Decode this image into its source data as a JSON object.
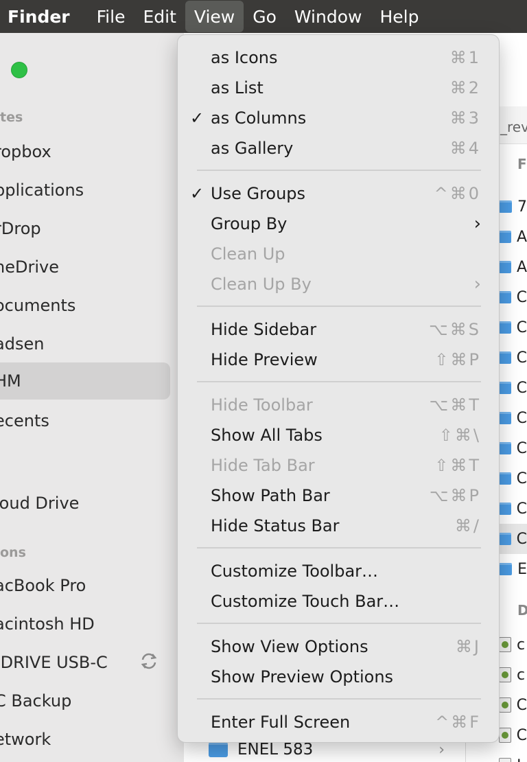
{
  "menubar": {
    "app": "Finder",
    "items": [
      "File",
      "Edit",
      "View",
      "Go",
      "Window",
      "Help"
    ]
  },
  "sidebar": {
    "section_favorites": "tes",
    "items_fav": [
      "ropbox",
      "pplications",
      "rDrop",
      "neDrive",
      "ocuments",
      "adsen",
      "HM",
      "ecents"
    ],
    "icloud": "loud Drive",
    "section_locations": "ons",
    "items_loc": [
      "acBook Pro",
      "acintosh HD",
      "-DRIVE USB-C",
      "C Backup",
      "etwork"
    ]
  },
  "column3": {
    "title": "_rev",
    "header_letter": "F",
    "section_letter": "D",
    "rows": [
      "7",
      "A",
      "A",
      "C",
      "C",
      "C",
      "C",
      "C",
      "C",
      "C",
      "C",
      "C",
      "E"
    ],
    "doc_rows": [
      "c",
      "c",
      "C",
      "C",
      "I"
    ]
  },
  "bottom_row": {
    "label": "ENEL 583"
  },
  "view_menu": {
    "items": [
      {
        "label": "as Icons",
        "shortcut": "⌘1",
        "check": "",
        "disabled": false
      },
      {
        "label": "as List",
        "shortcut": "⌘2",
        "check": "",
        "disabled": false
      },
      {
        "label": "as Columns",
        "shortcut": "⌘3",
        "check": "✓",
        "disabled": false
      },
      {
        "label": "as Gallery",
        "shortcut": "⌘4",
        "check": "",
        "disabled": false
      },
      {
        "label": "Use Groups",
        "shortcut": "^⌘0",
        "check": "✓",
        "disabled": false
      },
      {
        "label": "Group By",
        "shortcut": "",
        "check": "",
        "disabled": false
      },
      {
        "label": "Clean Up",
        "shortcut": "",
        "check": "",
        "disabled": true
      },
      {
        "label": "Clean Up By",
        "shortcut": "",
        "check": "",
        "disabled": true
      },
      {
        "label": "Hide Sidebar",
        "shortcut": "⌥⌘S",
        "check": "",
        "disabled": false
      },
      {
        "label": "Hide Preview",
        "shortcut": "⇧⌘P",
        "check": "",
        "disabled": false
      },
      {
        "label": "Hide Toolbar",
        "shortcut": "⌥⌘T",
        "check": "",
        "disabled": true
      },
      {
        "label": "Show All Tabs",
        "shortcut": "⇧⌘\\",
        "check": "",
        "disabled": false
      },
      {
        "label": "Hide Tab Bar",
        "shortcut": "⇧⌘T",
        "check": "",
        "disabled": true
      },
      {
        "label": "Show Path Bar",
        "shortcut": "⌥⌘P",
        "check": "",
        "disabled": false
      },
      {
        "label": "Hide Status Bar",
        "shortcut": "⌘/",
        "check": "",
        "disabled": false
      },
      {
        "label": "Customize Toolbar…",
        "shortcut": "",
        "check": "",
        "disabled": false
      },
      {
        "label": "Customize Touch Bar…",
        "shortcut": "",
        "check": "",
        "disabled": false
      },
      {
        "label": "Show View Options",
        "shortcut": "⌘J",
        "check": "",
        "disabled": false
      },
      {
        "label": "Show Preview Options",
        "shortcut": "",
        "check": "",
        "disabled": false
      },
      {
        "label": "Enter Full Screen",
        "shortcut": "^⌘F",
        "check": "",
        "disabled": false
      }
    ],
    "submenu_arrow": "›"
  },
  "colors": {
    "menubar_bg": "#3b3a38",
    "menu_bg": "#e8e8e8",
    "disabled_text": "#a5a5a5",
    "shortcut_text": "#a6a6a6",
    "traffic_green": "#2fc046",
    "folder_blue": "#4b9be3"
  }
}
